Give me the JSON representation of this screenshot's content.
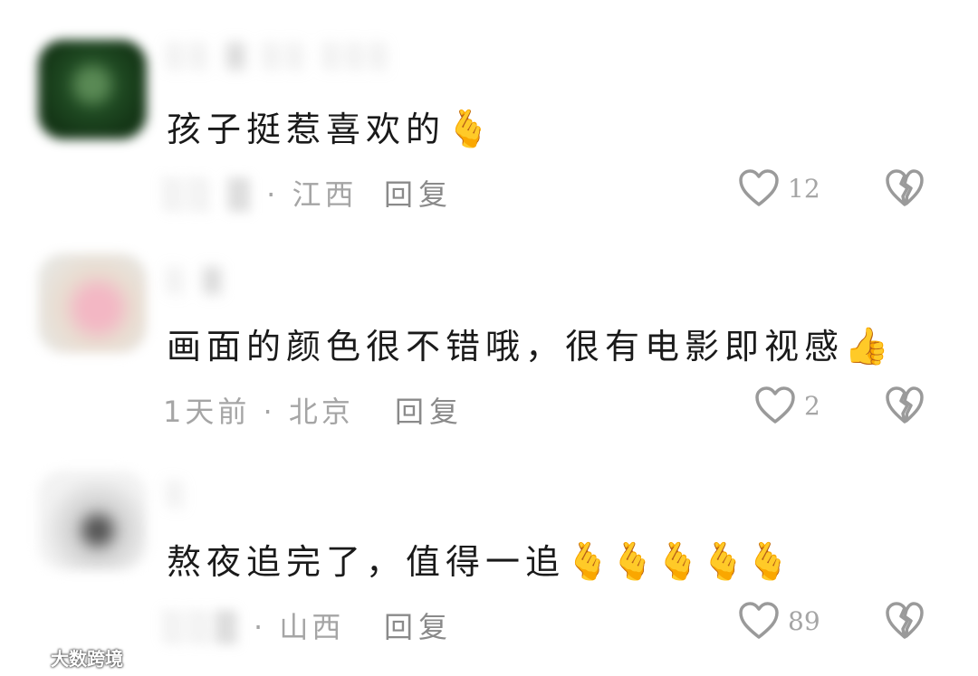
{
  "comments": [
    {
      "username": "░░ ▒ ░░ ░░░",
      "text": "孩子挺惹喜欢的",
      "emojis": [
        "🫰"
      ],
      "time": "░░ ▒",
      "location": "· 江西",
      "reply_label": "回复",
      "likes": "12"
    },
    {
      "username": "░ ▒",
      "text": "画面的颜色很不错哦，很有电影即视感",
      "emojis": [
        "👍"
      ],
      "time": "1天前",
      "location": "· 北京",
      "reply_label": "回复",
      "likes": "2"
    },
    {
      "username": "░",
      "text": "熬夜追完了，值得一追",
      "emojis": [
        "🫰",
        "🫰",
        "🫰",
        "🫰",
        "🫰"
      ],
      "time": "░░▒",
      "location": "· 山西",
      "reply_label": "回复",
      "likes": "89"
    }
  ],
  "watermark": "大数跨境",
  "colors": {
    "text": "#1a1a1a",
    "meta": "#a5a5a5",
    "reply": "#8a8a8a",
    "icon": "#9a9a9a"
  },
  "icons": {
    "like": "heart-outline-icon",
    "dislike": "broken-heart-icon"
  }
}
